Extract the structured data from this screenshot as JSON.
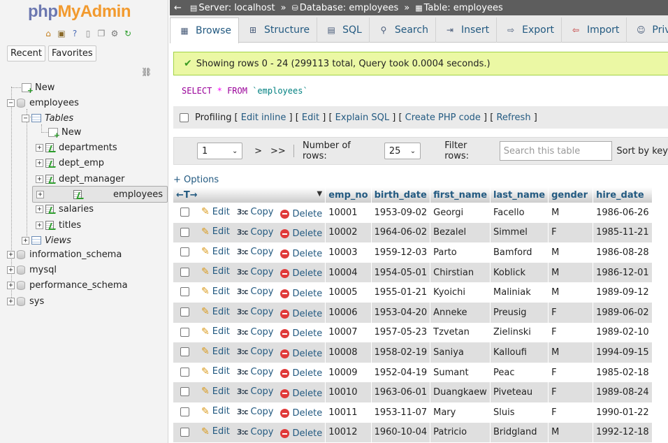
{
  "nav": {
    "logo_php": "php",
    "logo_myadmin": "MyAdmin",
    "tab_recent": "Recent",
    "tab_favorites": "Favorites",
    "tree": {
      "new": "New",
      "employees_db": "employees",
      "tables": "Tables",
      "tables_new": "New",
      "tables_list": [
        "departments",
        "dept_emp",
        "dept_manager",
        "employees",
        "salaries",
        "titles"
      ],
      "views": "Views",
      "other_dbs": [
        "information_schema",
        "mysql",
        "performance_schema",
        "sys"
      ]
    }
  },
  "breadcrumb": {
    "server": "Server: localhost",
    "database": "Database: employees",
    "table": "Table: employees",
    "sep": "»"
  },
  "tabs": [
    "Browse",
    "Structure",
    "SQL",
    "Search",
    "Insert",
    "Export",
    "Import",
    "Privile"
  ],
  "success_message": "Showing rows 0 - 24 (299113 total, Query took 0.0004 seconds.)",
  "sql": {
    "select": "SELECT",
    "star": "*",
    "from": "FROM",
    "table": "`employees`"
  },
  "profiling": {
    "label": "Profiling",
    "links": [
      "Edit inline",
      "Edit",
      "Explain SQL",
      "Create PHP code",
      "Refresh"
    ]
  },
  "pager": {
    "page": "1",
    "next": ">",
    "last": ">>",
    "rows_label": "Number of rows:",
    "rows_value": "25",
    "filter_label": "Filter rows:",
    "filter_placeholder": "Search this table",
    "sort_label": "Sort by key"
  },
  "options_link": "+ Options",
  "actions": {
    "edit": "Edit",
    "copy": "Copy",
    "delete": "Delete"
  },
  "columns": [
    "emp_no",
    "birth_date",
    "first_name",
    "last_name",
    "gender",
    "hire_date"
  ],
  "rows": [
    [
      "10001",
      "1953-09-02",
      "Georgi",
      "Facello",
      "M",
      "1986-06-26"
    ],
    [
      "10002",
      "1964-06-02",
      "Bezalel",
      "Simmel",
      "F",
      "1985-11-21"
    ],
    [
      "10003",
      "1959-12-03",
      "Parto",
      "Bamford",
      "M",
      "1986-08-28"
    ],
    [
      "10004",
      "1954-05-01",
      "Chirstian",
      "Koblick",
      "M",
      "1986-12-01"
    ],
    [
      "10005",
      "1955-01-21",
      "Kyoichi",
      "Maliniak",
      "M",
      "1989-09-12"
    ],
    [
      "10006",
      "1953-04-20",
      "Anneke",
      "Preusig",
      "F",
      "1989-06-02"
    ],
    [
      "10007",
      "1957-05-23",
      "Tzvetan",
      "Zielinski",
      "F",
      "1989-02-10"
    ],
    [
      "10008",
      "1958-02-19",
      "Saniya",
      "Kalloufi",
      "M",
      "1994-09-15"
    ],
    [
      "10009",
      "1952-04-19",
      "Sumant",
      "Peac",
      "F",
      "1985-02-18"
    ],
    [
      "10010",
      "1963-06-01",
      "Duangkaew",
      "Piveteau",
      "F",
      "1989-08-24"
    ],
    [
      "10011",
      "1953-11-07",
      "Mary",
      "Sluis",
      "F",
      "1990-01-22"
    ],
    [
      "10012",
      "1960-10-04",
      "Patricio",
      "Bridgland",
      "M",
      "1992-12-18"
    ]
  ]
}
